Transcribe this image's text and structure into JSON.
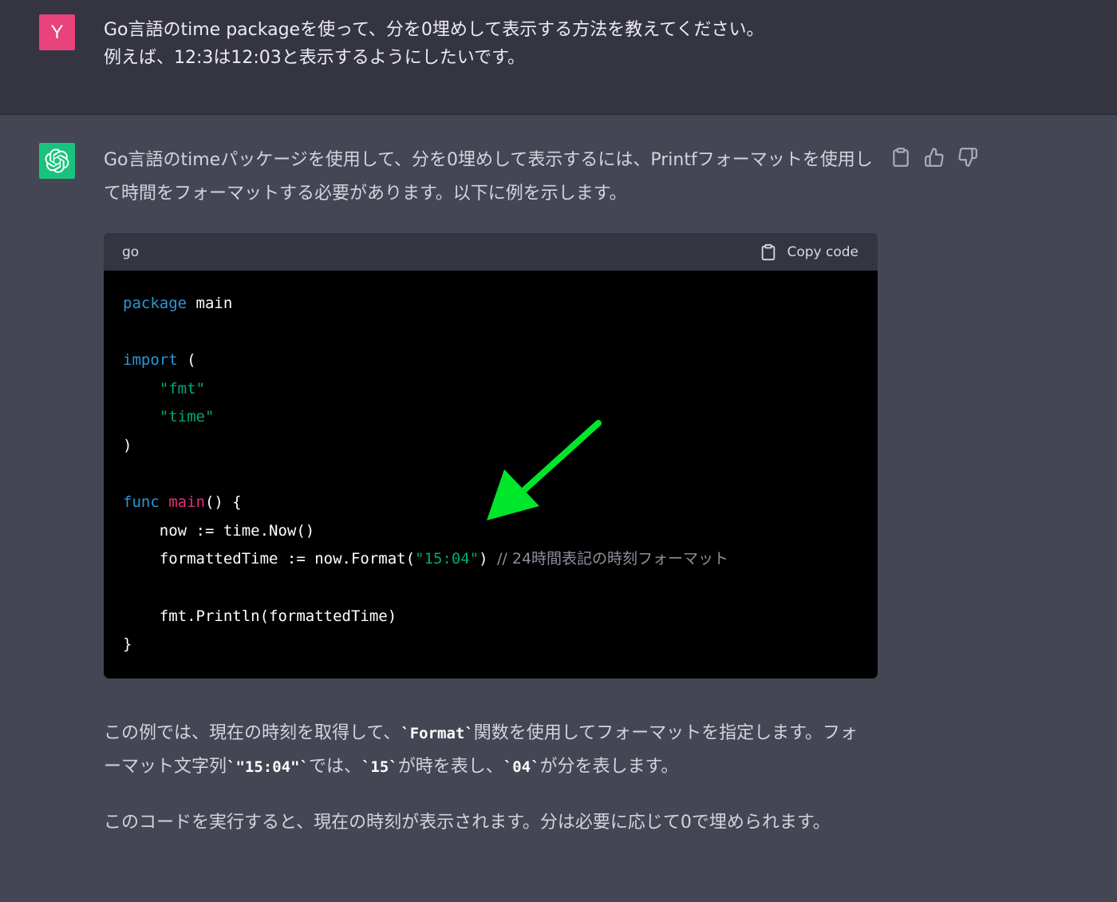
{
  "user": {
    "avatar_letter": "Y",
    "avatar_color": "#e8437a",
    "message_line1": "Go言語のtime packageを使って、分を0埋めして表示する方法を教えてください。",
    "message_line2": "例えば、12:3は12:03と表示するようにしたいです。"
  },
  "assistant": {
    "avatar_icon": "openai-logo-icon",
    "avatar_color": "#19c37d",
    "intro": "Go言語のtimeパッケージを使用して、分を0埋めして表示するには、Printfフォーマットを使用して時間をフォーマットする必要があります。以下に例を示します。",
    "actions": {
      "copy_icon": "clipboard-icon",
      "thumbs_up_icon": "thumbs-up-icon",
      "thumbs_down_icon": "thumbs-down-icon"
    },
    "code": {
      "language": "go",
      "copy_label": "Copy code",
      "tokens": {
        "package_kw": "package",
        "main_name": " main",
        "import_kw": "import",
        "open_paren": " (",
        "fmt_str": "\"fmt\"",
        "time_str": "\"time\"",
        "close_paren": ")",
        "func_kw": "func",
        "main_fn": " main",
        "func_tail": "() {",
        "now_line": "now := time.Now()",
        "format_pre": "formattedTime := now.Format(",
        "format_str": "\"15:04\"",
        "format_post": ") ",
        "comment": "// 24時間表記の時刻フォーマット",
        "println_line": "fmt.Println(formattedTime)",
        "close_brace": "}"
      }
    },
    "para2": {
      "part1": "この例では、現在の時刻を取得して、",
      "code1": "`Format`",
      "part2": "関数を使用してフォーマットを指定します。フォーマット文字列",
      "code2": "`\"15:04\"`",
      "part3": "では、",
      "code3": "`15`",
      "part4": "が時を表し、",
      "code4": "`04`",
      "part5": "が分を表します。"
    },
    "para3": "このコードを実行すると、現在の時刻が表示されます。分は必要に応じて0で埋められます。"
  },
  "annotation": {
    "arrow_color": "#00e62b"
  }
}
